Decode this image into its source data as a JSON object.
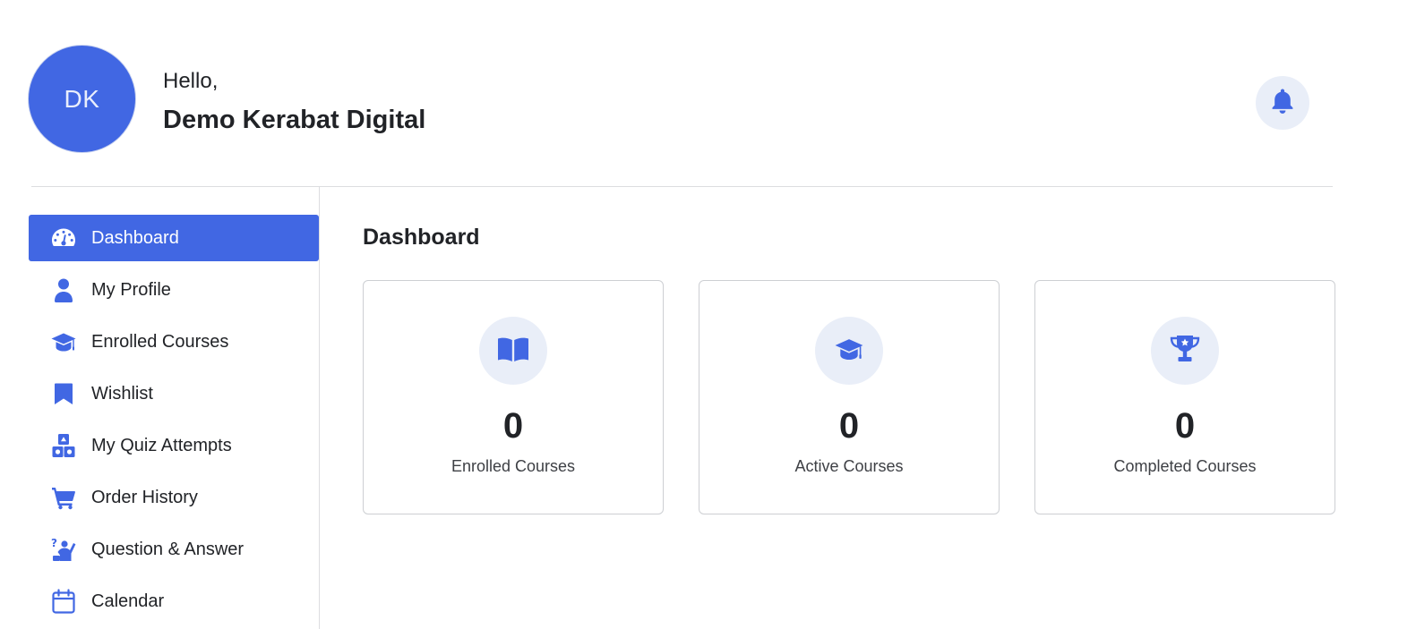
{
  "user": {
    "initials": "DK",
    "greeting": "Hello,",
    "name": "Demo Kerabat Digital"
  },
  "header": {
    "notification_icon": "bell-icon"
  },
  "colors": {
    "accent": "#4167e3",
    "icon_bg": "#e9eef8",
    "text": "#212327"
  },
  "sidebar": {
    "items": [
      {
        "label": "Dashboard",
        "icon": "dashboard-gauge-icon",
        "active": true
      },
      {
        "label": "My Profile",
        "icon": "user-icon",
        "active": false
      },
      {
        "label": "Enrolled Courses",
        "icon": "graduation-cap-icon",
        "active": false
      },
      {
        "label": "Wishlist",
        "icon": "bookmark-icon",
        "active": false
      },
      {
        "label": "My Quiz Attempts",
        "icon": "shapes-icon",
        "active": false
      },
      {
        "label": "Order History",
        "icon": "cart-icon",
        "active": false
      },
      {
        "label": "Question & Answer",
        "icon": "question-answer-icon",
        "active": false
      },
      {
        "label": "Calendar",
        "icon": "calendar-icon",
        "active": false
      }
    ]
  },
  "main": {
    "title": "Dashboard",
    "stats": [
      {
        "value": "0",
        "label": "Enrolled Courses",
        "icon": "book-open-icon"
      },
      {
        "value": "0",
        "label": "Active Courses",
        "icon": "graduation-cap-icon"
      },
      {
        "value": "0",
        "label": "Completed Courses",
        "icon": "trophy-icon"
      }
    ]
  }
}
